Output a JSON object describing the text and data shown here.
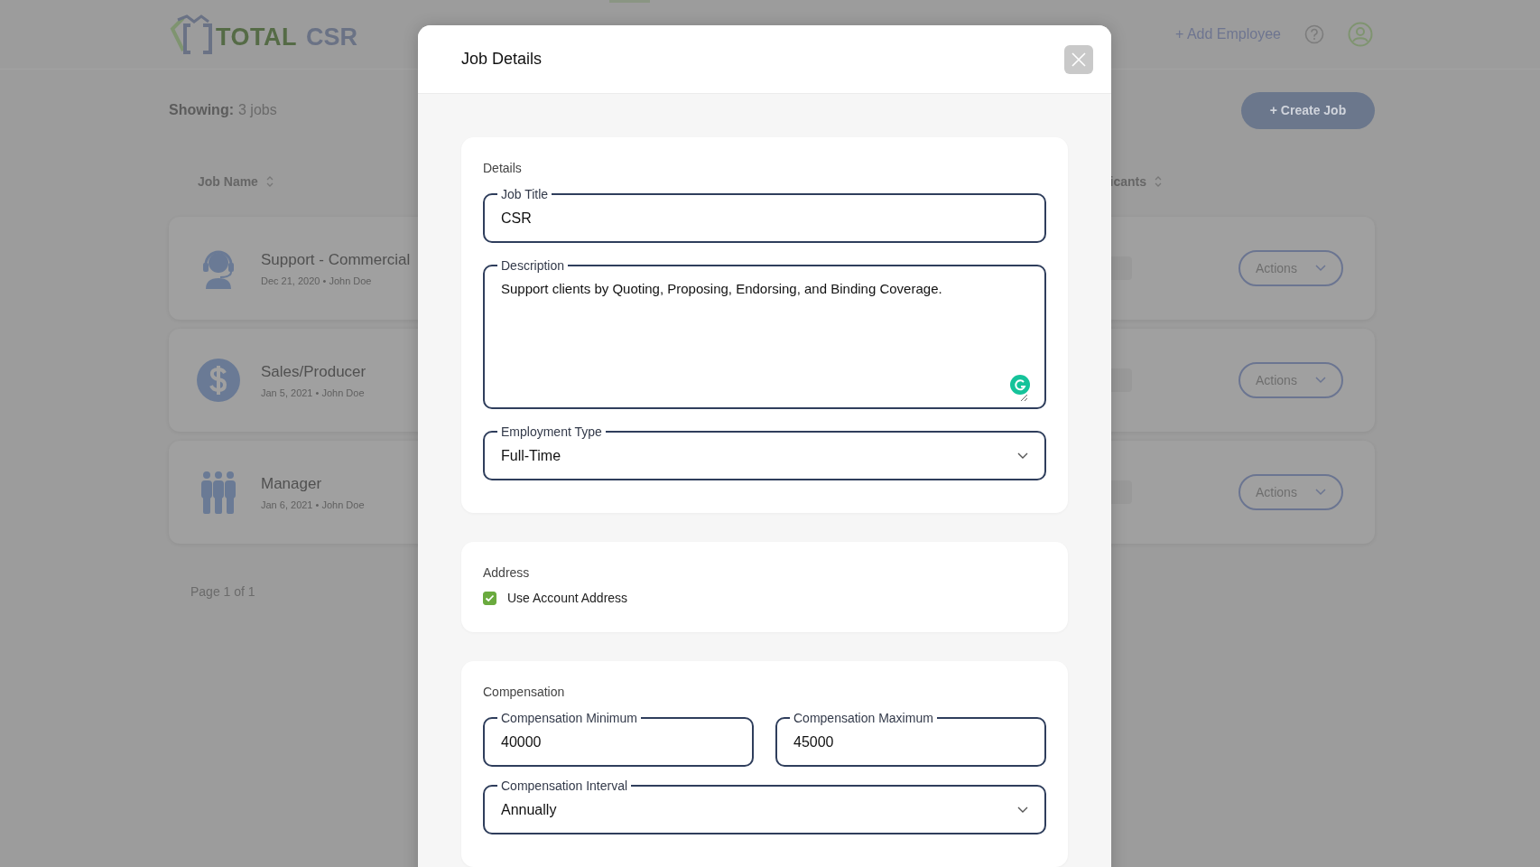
{
  "header": {
    "logo_words": [
      "TOTAL",
      "CSR"
    ],
    "add_employee": "+ Add Employee"
  },
  "toolbar": {
    "showing_label": "Showing:",
    "showing_value": "3 jobs",
    "create_button": "+ Create Job"
  },
  "columns": [
    {
      "label": "Job Name"
    },
    {
      "label": "icants"
    }
  ],
  "jobs": [
    {
      "kind": "headset",
      "title": "Support - Commercial",
      "meta": "Dec 21, 2020 • John Doe",
      "actions": "Actions"
    },
    {
      "kind": "dollar",
      "title": "Sales/Producer",
      "meta": "Jan 5, 2021 • John Doe",
      "actions": "Actions"
    },
    {
      "kind": "people",
      "title": "Manager",
      "meta": "Jan 6, 2021 • John Doe",
      "actions": "Actions"
    }
  ],
  "pagination": "Page 1 of 1",
  "modal": {
    "title": "Job Details",
    "details": {
      "heading": "Details",
      "job_title": {
        "label": "Job Title",
        "value": "CSR"
      },
      "description": {
        "label": "Description",
        "value": "Support clients by Quoting, Proposing, Endorsing, and Binding Coverage."
      },
      "employment_type": {
        "label": "Employment Type",
        "value": "Full-Time"
      }
    },
    "address": {
      "heading": "Address",
      "use_account_address": {
        "label": "Use Account Address",
        "checked": true
      }
    },
    "compensation": {
      "heading": "Compensation",
      "minimum": {
        "label": "Compensation Minimum",
        "value": "40000"
      },
      "maximum": {
        "label": "Compensation Maximum",
        "value": "45000"
      },
      "interval": {
        "label": "Compensation Interval",
        "value": "Annually"
      }
    }
  }
}
